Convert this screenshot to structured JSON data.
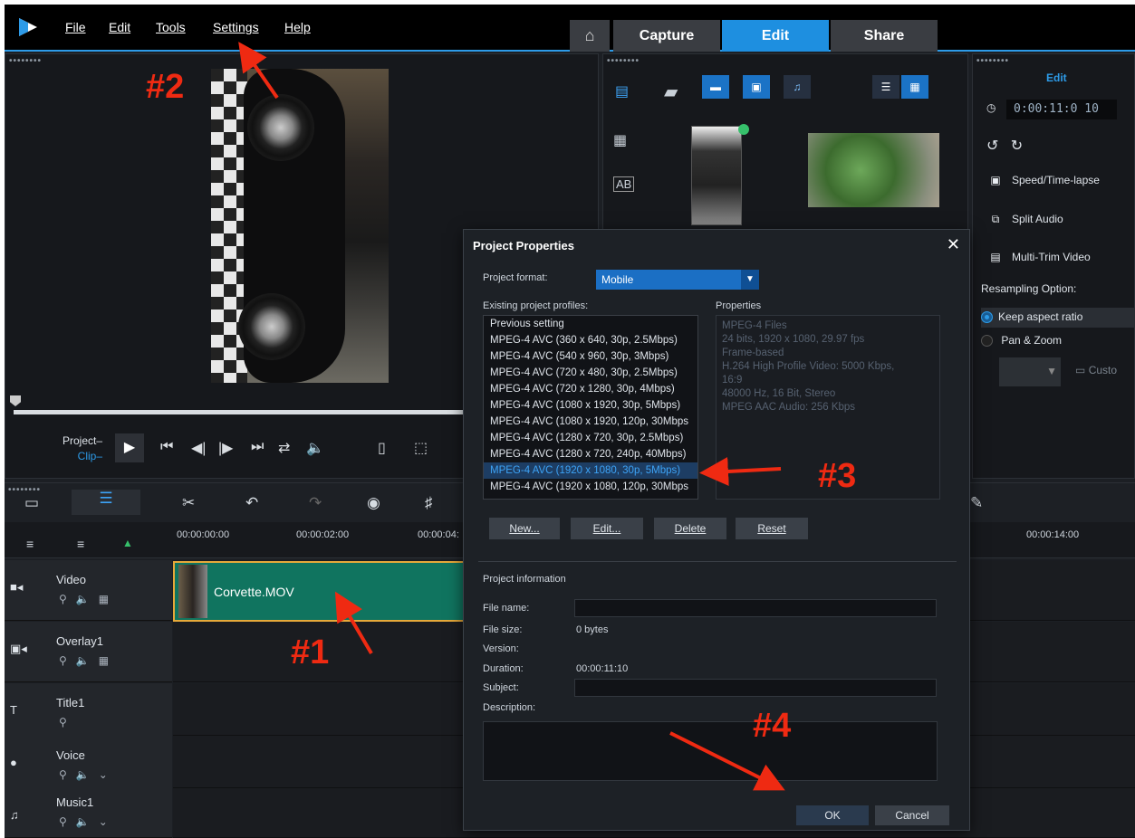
{
  "menu": {
    "items": [
      {
        "label": "File"
      },
      {
        "label": "Edit"
      },
      {
        "label": "Tools"
      },
      {
        "label": "Settings"
      },
      {
        "label": "Help"
      }
    ]
  },
  "tabs": {
    "capture": "Capture",
    "edit": "Edit",
    "share": "Share"
  },
  "player": {
    "project_label": "Project–",
    "clip_label": "Clip–"
  },
  "options": {
    "title": "Edit",
    "timecode": "0:00:11:0 10",
    "speed": "Speed/Time-lapse",
    "split_audio": "Split Audio",
    "multi_trim": "Multi-Trim Video",
    "resampling": "Resampling Option:",
    "keep_aspect": "Keep aspect ratio",
    "pan_zoom": "Pan & Zoom",
    "custom": "Custo"
  },
  "timeline": {
    "ruler": [
      "00:00:00:00",
      "00:00:02:00",
      "00:00:04:",
      "00:00:14:00"
    ],
    "tracks": [
      {
        "name": "Video"
      },
      {
        "name": "Overlay1"
      },
      {
        "name": "Title1"
      },
      {
        "name": "Voice"
      },
      {
        "name": "Music1"
      }
    ],
    "clip_name": "Corvette.MOV"
  },
  "dialog": {
    "title": "Project Properties",
    "close": "✕",
    "format_label": "Project format:",
    "format_value": "Mobile",
    "profiles_label": "Existing project profiles:",
    "properties_label": "Properties",
    "profiles": [
      "Previous setting",
      "MPEG-4 AVC (360 x 640, 30p, 2.5Mbps)",
      "MPEG-4 AVC (540 x 960, 30p, 3Mbps)",
      "MPEG-4 AVC (720 x 480, 30p, 2.5Mbps)",
      "MPEG-4 AVC (720 x 1280, 30p, 4Mbps)",
      "MPEG-4 AVC (1080 x 1920, 30p, 5Mbps)",
      "MPEG-4 AVC (1080 x 1920, 120p, 30Mbps",
      "MPEG-4 AVC (1280 x 720, 30p, 2.5Mbps)",
      "MPEG-4 AVC (1280 x 720, 240p, 40Mbps)",
      "MPEG-4 AVC (1920 x 1080, 30p, 5Mbps)",
      "MPEG-4 AVC (1920 x 1080, 120p, 30Mbps"
    ],
    "selected_profile": "MPEG-4 AVC (1920 x 1080, 30p, 5Mbps)",
    "properties": [
      "MPEG-4 Files",
      "24 bits, 1920 x 1080, 29.97 fps",
      "Frame-based",
      "H.264 High Profile Video: 5000 Kbps,",
      "16:9",
      "48000 Hz, 16 Bit, Stereo",
      "MPEG AAC Audio: 256 Kbps"
    ],
    "buttons": {
      "new": "New...",
      "edit": "Edit...",
      "delete": "Delete",
      "reset": "Reset"
    },
    "info_title": "Project information",
    "file_name_label": "File name:",
    "file_size_label": "File size:",
    "file_size_value": "0 bytes",
    "version_label": "Version:",
    "duration_label": "Duration:",
    "duration_value": "00:00:11:10",
    "subject_label": "Subject:",
    "description_label": "Description:",
    "ok": "OK",
    "cancel": "Cancel"
  },
  "annotations": {
    "a1": "#1",
    "a2": "#2",
    "a3": "#3",
    "a4": "#4"
  },
  "colors": {
    "accent": "#2d9be8",
    "annotation": "#ef2a12",
    "clip": "#10745f"
  }
}
